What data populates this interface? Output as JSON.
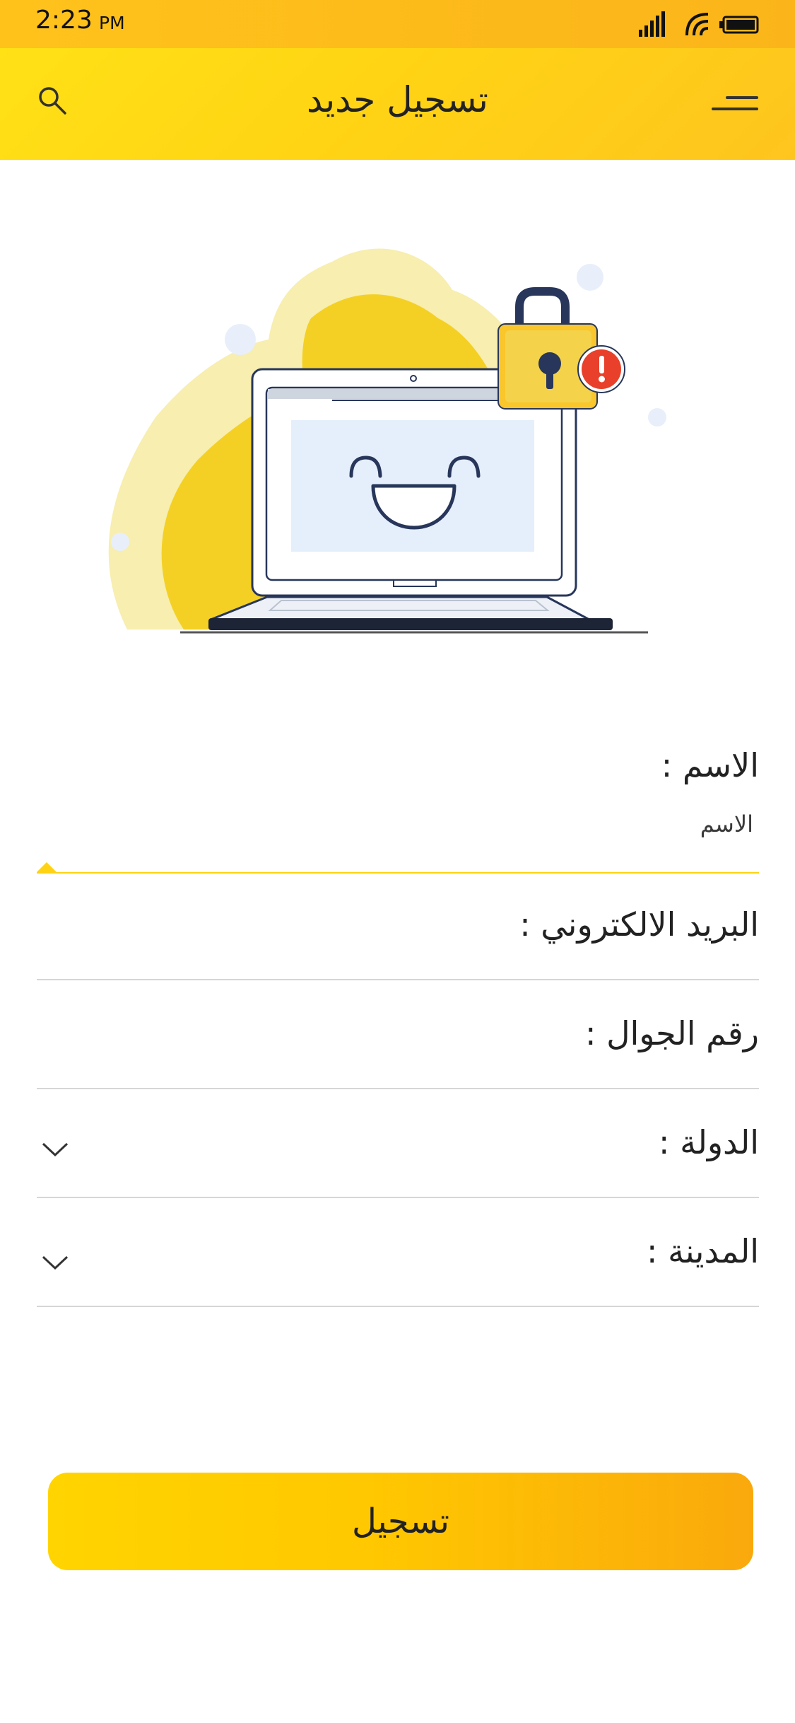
{
  "status_bar": {
    "time": "2:23",
    "ampm": "PM",
    "icons": [
      "signal-icon",
      "wifi-icon",
      "battery-icon"
    ]
  },
  "header": {
    "title": "تسجيل جديد",
    "left_icon": "search-icon",
    "right_icon": "menu-icon"
  },
  "form": {
    "name": {
      "label": "الاسم :",
      "placeholder": "الاسم"
    },
    "email": {
      "label": "البريد الالكتروني :"
    },
    "phone": {
      "label": "رقم الجوال :"
    },
    "country": {
      "label": "الدولة :",
      "icon": "chevron-down-icon"
    },
    "city": {
      "label": "المدينة :",
      "icon": "chevron-down-icon"
    }
  },
  "submit": {
    "label": "تسجيل"
  },
  "colors": {
    "primary": "#ffd314",
    "accent": "#faa90c",
    "navy": "#27365a",
    "alert": "#e8402a",
    "divider": "#d6d6d6"
  }
}
